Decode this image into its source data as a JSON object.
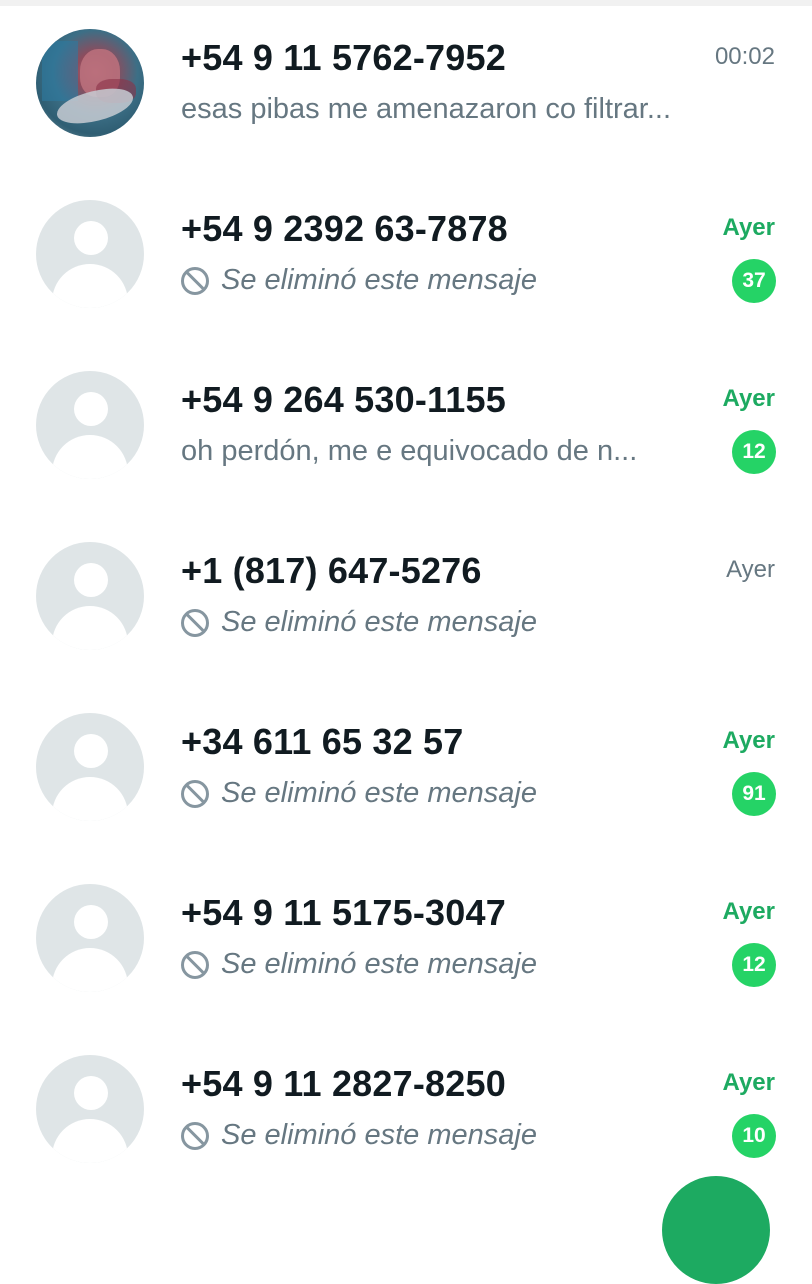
{
  "chat_list": {
    "rows": [
      {
        "name": "+54 9 11 5762-7952",
        "time": "00:02",
        "preview": "esas pibas me amenazaron co  filtrar...",
        "avatar": "photo",
        "deleted": false,
        "unread": ""
      },
      {
        "name": "+54 9 2392 63-7878",
        "time": "Ayer",
        "preview": "Se eliminó este mensaje",
        "avatar": "default-avatar-icon",
        "deleted": true,
        "unread": "37"
      },
      {
        "name": "+54 9 264 530-1155",
        "time": "Ayer",
        "preview": "oh perdón, me e equivocado de n...",
        "avatar": "default-avatar-icon",
        "deleted": false,
        "unread": "12"
      },
      {
        "name": "+1 (817) 647-5276",
        "time": "Ayer",
        "preview": "Se eliminó este mensaje",
        "avatar": "default-avatar-icon",
        "deleted": true,
        "unread": ""
      },
      {
        "name": "+34 611 65 32 57",
        "time": "Ayer",
        "preview": "Se eliminó este mensaje",
        "avatar": "default-avatar-icon",
        "deleted": true,
        "unread": "91"
      },
      {
        "name": "+54 9 11 5175-3047",
        "time": "Ayer",
        "preview": "Se eliminó este mensaje",
        "avatar": "default-avatar-icon",
        "deleted": true,
        "unread": "12"
      },
      {
        "name": "+54 9 11 2827-8250",
        "time": "Ayer",
        "preview": "Se eliminó este mensaje",
        "avatar": "default-avatar-icon",
        "deleted": true,
        "unread": "10"
      }
    ]
  },
  "colors": {
    "accent_green": "#25d366",
    "unread_time_green": "#1daa61",
    "name_text": "#111b21",
    "secondary_text": "#667781",
    "avatar_bg": "#dfe5e7"
  },
  "icons": {
    "deleted": "ban-icon",
    "default_avatar": "default-avatar-icon",
    "fab": "new-chat-button"
  }
}
